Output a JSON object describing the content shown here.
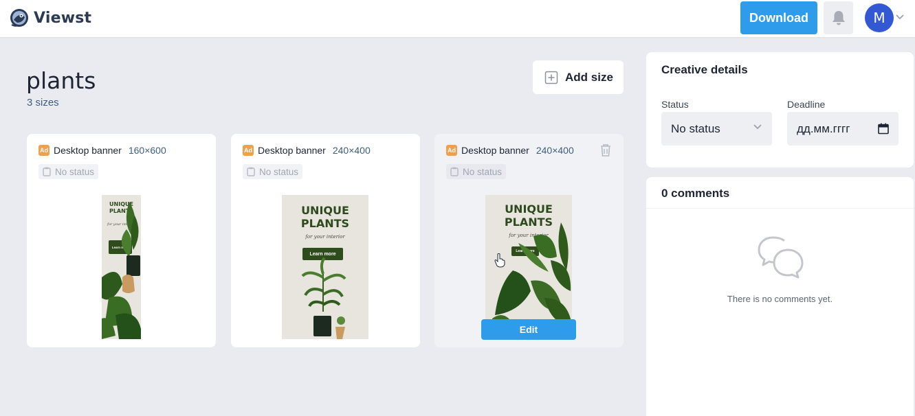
{
  "header": {
    "app_name": "Viewst",
    "download_label": "Download",
    "avatar_initial": "M",
    "accent_color": "#2f9ceb"
  },
  "project": {
    "title": "plants",
    "sizes_count_label": "3 sizes",
    "add_size_label": "Add size"
  },
  "cards": [
    {
      "badge": "Ad",
      "name": "Desktop banner",
      "size": "160×600",
      "status": "No status",
      "banner": {
        "title_line1": "UNIQUE",
        "title_line2": "PLANTS",
        "subtitle": "for your interior",
        "button": "Learn more"
      }
    },
    {
      "badge": "Ad",
      "name": "Desktop banner",
      "size": "240×400",
      "status": "No status",
      "banner": {
        "title_line1": "UNIQUE",
        "title_line2": "PLANTS",
        "subtitle": "for your interior",
        "button": "Learn more"
      }
    },
    {
      "badge": "Ad",
      "name": "Desktop banner",
      "size": "240×400",
      "status": "No status",
      "edit_label": "Edit",
      "banner": {
        "title_line1": "UNIQUE",
        "title_line2": "PLANTS",
        "subtitle": "for your interior",
        "button": "Learn more"
      }
    }
  ],
  "details": {
    "title": "Creative details",
    "status_label": "Status",
    "status_value": "No status",
    "deadline_label": "Deadline",
    "deadline_placeholder": "дд.мм.гггг"
  },
  "comments": {
    "title": "0 comments",
    "empty_text": "There is no comments yet."
  }
}
